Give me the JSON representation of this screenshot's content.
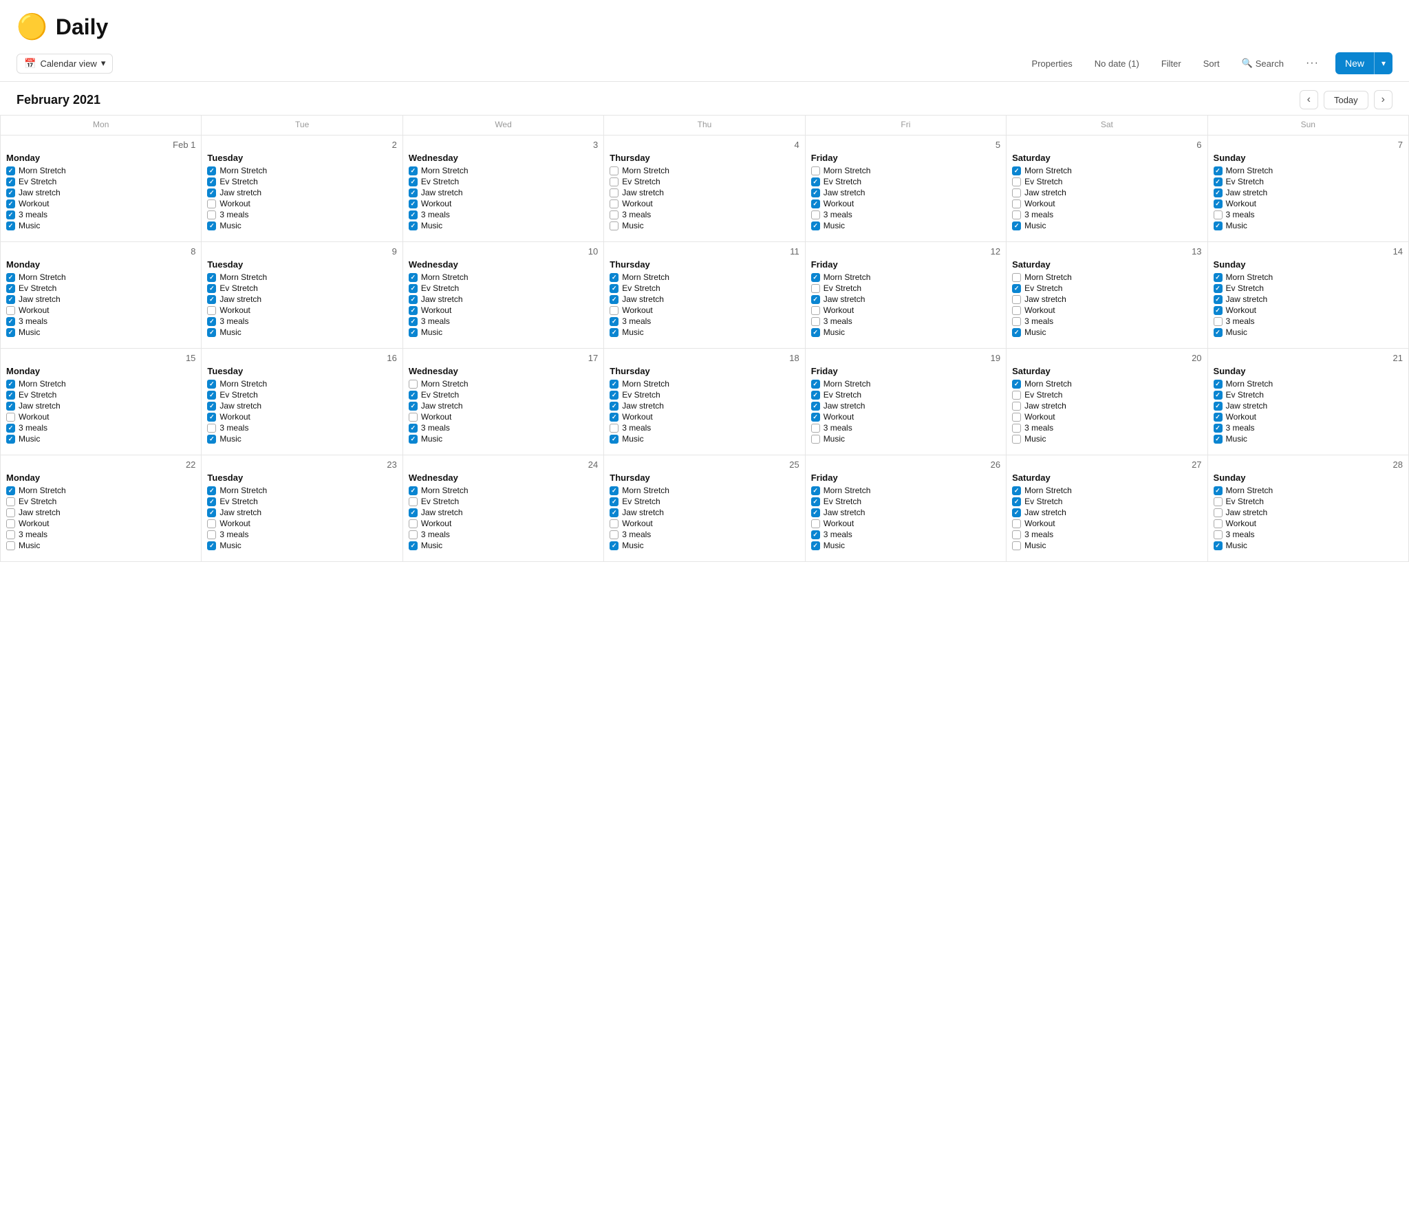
{
  "app": {
    "icon": "🟡",
    "title": "Daily"
  },
  "toolbar": {
    "calendar_view_label": "Calendar view",
    "properties_label": "Properties",
    "no_date_label": "No date (1)",
    "filter_label": "Filter",
    "sort_label": "Sort",
    "search_label": "Search",
    "new_label": "New"
  },
  "calendar": {
    "month_title": "February 2021",
    "today_label": "Today",
    "day_headers": [
      "Mon",
      "Tue",
      "Wed",
      "Thu",
      "Fri",
      "Sat",
      "Sun"
    ]
  },
  "weeks": [
    {
      "days": [
        {
          "number": "Feb 1",
          "label": "Monday",
          "tasks": [
            {
              "text": "Morn Stretch",
              "checked": true
            },
            {
              "text": "Ev Stretch",
              "checked": true
            },
            {
              "text": "Jaw stretch",
              "checked": true
            },
            {
              "text": "Workout",
              "checked": true
            },
            {
              "text": "3 meals",
              "checked": true
            },
            {
              "text": "Music",
              "checked": true
            }
          ]
        },
        {
          "number": "2",
          "label": "Tuesday",
          "tasks": [
            {
              "text": "Morn Stretch",
              "checked": true
            },
            {
              "text": "Ev Stretch",
              "checked": true
            },
            {
              "text": "Jaw stretch",
              "checked": true
            },
            {
              "text": "Workout",
              "checked": false
            },
            {
              "text": "3 meals",
              "checked": false
            },
            {
              "text": "Music",
              "checked": true
            }
          ]
        },
        {
          "number": "3",
          "label": "Wednesday",
          "tasks": [
            {
              "text": "Morn Stretch",
              "checked": true
            },
            {
              "text": "Ev Stretch",
              "checked": true
            },
            {
              "text": "Jaw stretch",
              "checked": true
            },
            {
              "text": "Workout",
              "checked": true
            },
            {
              "text": "3 meals",
              "checked": true
            },
            {
              "text": "Music",
              "checked": true
            }
          ]
        },
        {
          "number": "4",
          "label": "Thursday",
          "tasks": [
            {
              "text": "Morn Stretch",
              "checked": false
            },
            {
              "text": "Ev Stretch",
              "checked": false
            },
            {
              "text": "Jaw stretch",
              "checked": false
            },
            {
              "text": "Workout",
              "checked": false
            },
            {
              "text": "3 meals",
              "checked": false
            },
            {
              "text": "Music",
              "checked": false
            }
          ]
        },
        {
          "number": "5",
          "label": "Friday",
          "tasks": [
            {
              "text": "Morn Stretch",
              "checked": false
            },
            {
              "text": "Ev Stretch",
              "checked": true
            },
            {
              "text": "Jaw stretch",
              "checked": true
            },
            {
              "text": "Workout",
              "checked": true
            },
            {
              "text": "3 meals",
              "checked": false
            },
            {
              "text": "Music",
              "checked": true
            }
          ]
        },
        {
          "number": "6",
          "label": "Saturday",
          "tasks": [
            {
              "text": "Morn Stretch",
              "checked": true
            },
            {
              "text": "Ev Stretch",
              "checked": false
            },
            {
              "text": "Jaw stretch",
              "checked": false
            },
            {
              "text": "Workout",
              "checked": false
            },
            {
              "text": "3 meals",
              "checked": false
            },
            {
              "text": "Music",
              "checked": true
            }
          ]
        },
        {
          "number": "7",
          "label": "Sunday",
          "tasks": [
            {
              "text": "Morn Stretch",
              "checked": true
            },
            {
              "text": "Ev Stretch",
              "checked": true
            },
            {
              "text": "Jaw stretch",
              "checked": true
            },
            {
              "text": "Workout",
              "checked": true
            },
            {
              "text": "3 meals",
              "checked": false
            },
            {
              "text": "Music",
              "checked": true
            }
          ]
        }
      ]
    },
    {
      "days": [
        {
          "number": "8",
          "label": "Monday",
          "tasks": [
            {
              "text": "Morn Stretch",
              "checked": true
            },
            {
              "text": "Ev Stretch",
              "checked": true
            },
            {
              "text": "Jaw stretch",
              "checked": true
            },
            {
              "text": "Workout",
              "checked": false
            },
            {
              "text": "3 meals",
              "checked": true
            },
            {
              "text": "Music",
              "checked": true
            }
          ]
        },
        {
          "number": "9",
          "label": "Tuesday",
          "tasks": [
            {
              "text": "Morn Stretch",
              "checked": true
            },
            {
              "text": "Ev Stretch",
              "checked": true
            },
            {
              "text": "Jaw stretch",
              "checked": true
            },
            {
              "text": "Workout",
              "checked": false
            },
            {
              "text": "3 meals",
              "checked": true
            },
            {
              "text": "Music",
              "checked": true
            }
          ]
        },
        {
          "number": "10",
          "label": "Wednesday",
          "tasks": [
            {
              "text": "Morn Stretch",
              "checked": true
            },
            {
              "text": "Ev Stretch",
              "checked": true
            },
            {
              "text": "Jaw stretch",
              "checked": true
            },
            {
              "text": "Workout",
              "checked": true
            },
            {
              "text": "3 meals",
              "checked": true
            },
            {
              "text": "Music",
              "checked": true
            }
          ]
        },
        {
          "number": "11",
          "label": "Thursday",
          "tasks": [
            {
              "text": "Morn Stretch",
              "checked": true
            },
            {
              "text": "Ev Stretch",
              "checked": true
            },
            {
              "text": "Jaw stretch",
              "checked": true
            },
            {
              "text": "Workout",
              "checked": false
            },
            {
              "text": "3 meals",
              "checked": true
            },
            {
              "text": "Music",
              "checked": true
            }
          ]
        },
        {
          "number": "12",
          "label": "Friday",
          "tasks": [
            {
              "text": "Morn Stretch",
              "checked": true
            },
            {
              "text": "Ev Stretch",
              "checked": false
            },
            {
              "text": "Jaw stretch",
              "checked": true
            },
            {
              "text": "Workout",
              "checked": false
            },
            {
              "text": "3 meals",
              "checked": false
            },
            {
              "text": "Music",
              "checked": true
            }
          ]
        },
        {
          "number": "13",
          "label": "Saturday",
          "tasks": [
            {
              "text": "Morn Stretch",
              "checked": false
            },
            {
              "text": "Ev Stretch",
              "checked": true
            },
            {
              "text": "Jaw stretch",
              "checked": false
            },
            {
              "text": "Workout",
              "checked": false
            },
            {
              "text": "3 meals",
              "checked": false
            },
            {
              "text": "Music",
              "checked": true
            }
          ]
        },
        {
          "number": "14",
          "label": "Sunday",
          "tasks": [
            {
              "text": "Morn Stretch",
              "checked": true
            },
            {
              "text": "Ev Stretch",
              "checked": true
            },
            {
              "text": "Jaw stretch",
              "checked": true
            },
            {
              "text": "Workout",
              "checked": true
            },
            {
              "text": "3 meals",
              "checked": false
            },
            {
              "text": "Music",
              "checked": true
            }
          ]
        }
      ]
    },
    {
      "days": [
        {
          "number": "15",
          "label": "Monday",
          "tasks": [
            {
              "text": "Morn Stretch",
              "checked": true
            },
            {
              "text": "Ev Stretch",
              "checked": true
            },
            {
              "text": "Jaw stretch",
              "checked": true
            },
            {
              "text": "Workout",
              "checked": false
            },
            {
              "text": "3 meals",
              "checked": true
            },
            {
              "text": "Music",
              "checked": true
            }
          ]
        },
        {
          "number": "16",
          "label": "Tuesday",
          "tasks": [
            {
              "text": "Morn Stretch",
              "checked": true
            },
            {
              "text": "Ev Stretch",
              "checked": true
            },
            {
              "text": "Jaw stretch",
              "checked": true
            },
            {
              "text": "Workout",
              "checked": true
            },
            {
              "text": "3 meals",
              "checked": false
            },
            {
              "text": "Music",
              "checked": true
            }
          ]
        },
        {
          "number": "17",
          "label": "Wednesday",
          "tasks": [
            {
              "text": "Morn Stretch",
              "checked": false
            },
            {
              "text": "Ev Stretch",
              "checked": true
            },
            {
              "text": "Jaw stretch",
              "checked": true
            },
            {
              "text": "Workout",
              "checked": false
            },
            {
              "text": "3 meals",
              "checked": true
            },
            {
              "text": "Music",
              "checked": true
            }
          ]
        },
        {
          "number": "18",
          "label": "Thursday",
          "tasks": [
            {
              "text": "Morn Stretch",
              "checked": true
            },
            {
              "text": "Ev Stretch",
              "checked": true
            },
            {
              "text": "Jaw stretch",
              "checked": true
            },
            {
              "text": "Workout",
              "checked": true
            },
            {
              "text": "3 meals",
              "checked": false
            },
            {
              "text": "Music",
              "checked": true
            }
          ]
        },
        {
          "number": "19",
          "label": "Friday",
          "tasks": [
            {
              "text": "Morn Stretch",
              "checked": true
            },
            {
              "text": "Ev Stretch",
              "checked": true
            },
            {
              "text": "Jaw stretch",
              "checked": true
            },
            {
              "text": "Workout",
              "checked": true
            },
            {
              "text": "3 meals",
              "checked": false
            },
            {
              "text": "Music",
              "checked": false
            }
          ]
        },
        {
          "number": "20",
          "label": "Saturday",
          "tasks": [
            {
              "text": "Morn Stretch",
              "checked": true
            },
            {
              "text": "Ev Stretch",
              "checked": false
            },
            {
              "text": "Jaw stretch",
              "checked": false
            },
            {
              "text": "Workout",
              "checked": false
            },
            {
              "text": "3 meals",
              "checked": false
            },
            {
              "text": "Music",
              "checked": false
            }
          ]
        },
        {
          "number": "21",
          "label": "Sunday",
          "tasks": [
            {
              "text": "Morn Stretch",
              "checked": true
            },
            {
              "text": "Ev Stretch",
              "checked": true
            },
            {
              "text": "Jaw stretch",
              "checked": true
            },
            {
              "text": "Workout",
              "checked": true
            },
            {
              "text": "3 meals",
              "checked": true
            },
            {
              "text": "Music",
              "checked": true
            }
          ]
        }
      ]
    },
    {
      "days": [
        {
          "number": "22",
          "label": "Monday",
          "tasks": [
            {
              "text": "Morn Stretch",
              "checked": true
            },
            {
              "text": "Ev Stretch",
              "checked": false
            },
            {
              "text": "Jaw stretch",
              "checked": false
            },
            {
              "text": "Workout",
              "checked": false
            },
            {
              "text": "3 meals",
              "checked": false
            },
            {
              "text": "Music",
              "checked": false
            }
          ]
        },
        {
          "number": "23",
          "label": "Tuesday",
          "tasks": [
            {
              "text": "Morn Stretch",
              "checked": true
            },
            {
              "text": "Ev Stretch",
              "checked": true
            },
            {
              "text": "Jaw stretch",
              "checked": true
            },
            {
              "text": "Workout",
              "checked": false
            },
            {
              "text": "3 meals",
              "checked": false
            },
            {
              "text": "Music",
              "checked": true
            }
          ]
        },
        {
          "number": "24",
          "label": "Wednesday",
          "tasks": [
            {
              "text": "Morn Stretch",
              "checked": true
            },
            {
              "text": "Ev Stretch",
              "checked": false
            },
            {
              "text": "Jaw stretch",
              "checked": true
            },
            {
              "text": "Workout",
              "checked": false
            },
            {
              "text": "3 meals",
              "checked": false
            },
            {
              "text": "Music",
              "checked": true
            }
          ]
        },
        {
          "number": "25",
          "label": "Thursday",
          "tasks": [
            {
              "text": "Morn Stretch",
              "checked": true
            },
            {
              "text": "Ev Stretch",
              "checked": true
            },
            {
              "text": "Jaw stretch",
              "checked": true
            },
            {
              "text": "Workout",
              "checked": false
            },
            {
              "text": "3 meals",
              "checked": false
            },
            {
              "text": "Music",
              "checked": true
            }
          ]
        },
        {
          "number": "26",
          "label": "Friday",
          "tasks": [
            {
              "text": "Morn Stretch",
              "checked": true
            },
            {
              "text": "Ev Stretch",
              "checked": true
            },
            {
              "text": "Jaw stretch",
              "checked": true
            },
            {
              "text": "Workout",
              "checked": false
            },
            {
              "text": "3 meals",
              "checked": true
            },
            {
              "text": "Music",
              "checked": true
            }
          ]
        },
        {
          "number": "27",
          "label": "Saturday",
          "tasks": [
            {
              "text": "Morn Stretch",
              "checked": true
            },
            {
              "text": "Ev Stretch",
              "checked": true
            },
            {
              "text": "Jaw stretch",
              "checked": true
            },
            {
              "text": "Workout",
              "checked": false
            },
            {
              "text": "3 meals",
              "checked": false
            },
            {
              "text": "Music",
              "checked": false
            }
          ]
        },
        {
          "number": "28",
          "label": "Sunday",
          "tasks": [
            {
              "text": "Morn Stretch",
              "checked": true
            },
            {
              "text": "Ev Stretch",
              "checked": false
            },
            {
              "text": "Jaw stretch",
              "checked": false
            },
            {
              "text": "Workout",
              "checked": false
            },
            {
              "text": "3 meals",
              "checked": false
            },
            {
              "text": "Music",
              "checked": true
            }
          ]
        }
      ]
    }
  ]
}
